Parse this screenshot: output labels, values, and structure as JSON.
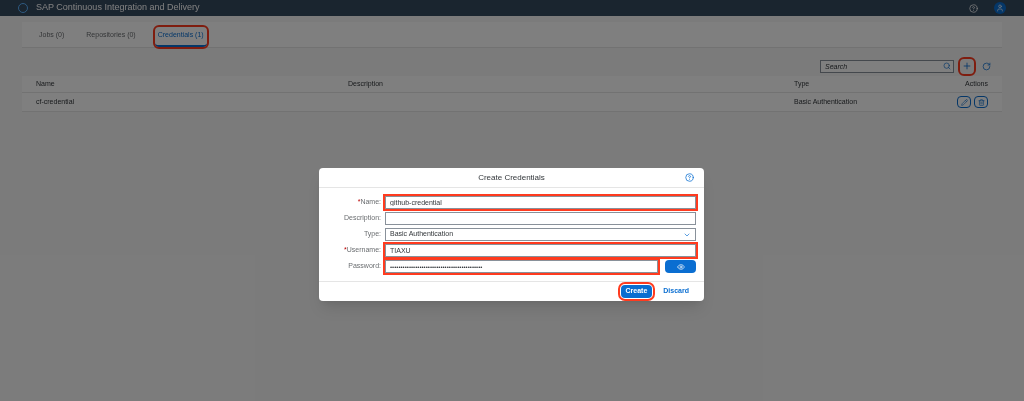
{
  "header": {
    "title": "SAP Continuous Integration and Delivery"
  },
  "tabs": [
    {
      "label": "Jobs (0)",
      "selected": false,
      "highlighted": false
    },
    {
      "label": "Repositories (0)",
      "selected": false,
      "highlighted": false
    },
    {
      "label": "Credentials (1)",
      "selected": true,
      "highlighted": true
    }
  ],
  "toolbar": {
    "search": {
      "placeholder": "Search"
    },
    "add_highlighted": true
  },
  "table": {
    "columns": [
      "Name",
      "Description",
      "Type",
      "Actions"
    ],
    "rows": [
      {
        "name": "cf-credential",
        "type": "Basic Authentication"
      }
    ]
  },
  "dialog": {
    "title": "Create Credentials",
    "fields": [
      {
        "kind": "text",
        "label": "Name:",
        "required_mark": "*",
        "value": "github-credential",
        "highlighted": true
      },
      {
        "kind": "text",
        "label": "Description:",
        "highlighted": false
      },
      {
        "kind": "select",
        "label": "Type:",
        "value": "Basic Authentication",
        "highlighted": false
      },
      {
        "kind": "text",
        "label": "Username:",
        "required_mark": "*",
        "value": "TIAXU",
        "highlighted": true
      },
      {
        "kind": "password",
        "label": "Password:",
        "value": "••••••••••••••••••••••••••••••••••••••••••••",
        "highlighted": true
      }
    ],
    "buttons": [
      {
        "label": "Create",
        "kind": "primary",
        "highlighted": true
      },
      {
        "label": "Discard",
        "kind": "link",
        "highlighted": false
      }
    ]
  }
}
